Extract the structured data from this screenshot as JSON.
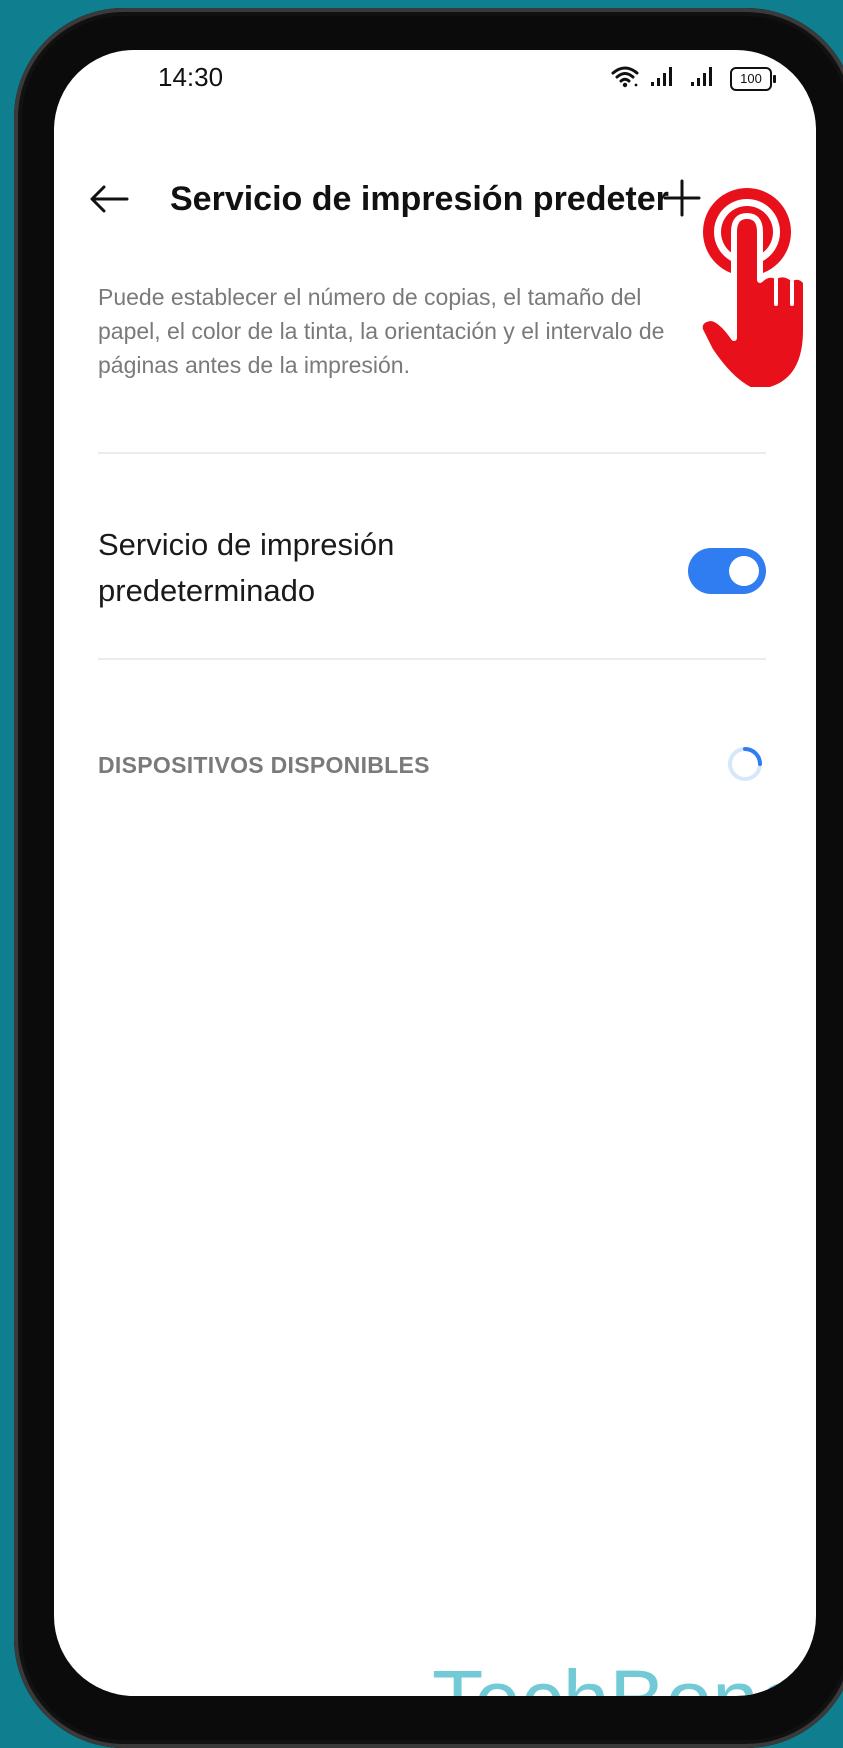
{
  "status_bar": {
    "time": "14:30",
    "battery": "100",
    "icons": [
      "wifi-icon",
      "signal-icon",
      "signal-icon",
      "battery-icon"
    ]
  },
  "app_bar": {
    "back_icon": "arrow-left-icon",
    "title": "Servicio de impresión predeterm...",
    "add_icon": "plus-icon"
  },
  "description": "Puede establecer el número de copias, el tamaño del papel, el color de la tinta, la orientación y el intervalo de páginas antes de la impresión.",
  "default_service": {
    "label": "Servicio de impresión predeterminado",
    "enabled": true
  },
  "available_devices": {
    "header": "DISPOSITIVOS DISPONIBLES",
    "loading": true
  },
  "watermark": "TechBone",
  "colors": {
    "background": "#0f7f8f",
    "accent": "#2f7df0",
    "hand": "#e8101a",
    "watermark": "#59c1ce"
  }
}
